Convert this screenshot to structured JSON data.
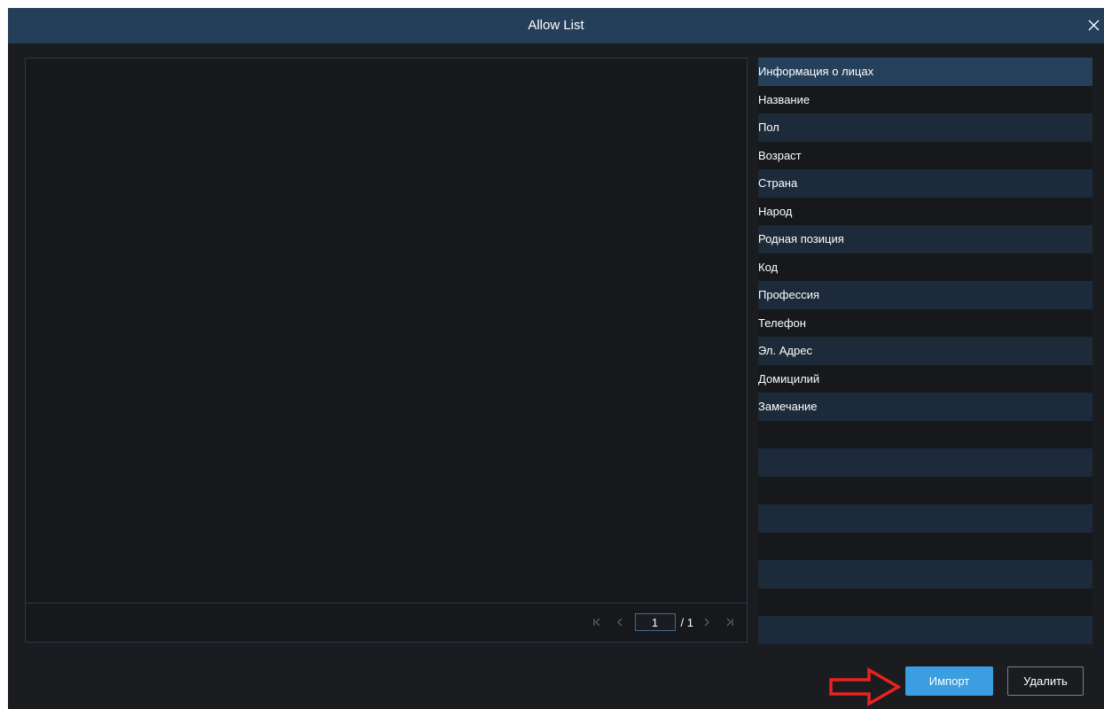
{
  "dialog": {
    "title": "Allow List",
    "close_icon": "close-icon"
  },
  "pager": {
    "current_page": "1",
    "total": "/ 1",
    "icons": [
      "first-page-icon",
      "prev-page-icon",
      "next-page-icon",
      "last-page-icon"
    ]
  },
  "info_panel": {
    "header": "Информация о лицах",
    "fields": [
      "Название",
      "Пол",
      "Возраст",
      "Страна",
      "Народ",
      "Родная позиция",
      "Код",
      "Профессия",
      "Телефон",
      "Эл. Адрес",
      "Домицилий",
      "Замечание"
    ],
    "empty_rows": 8
  },
  "buttons": {
    "import_label": "Импорт",
    "delete_label": "Удалить"
  },
  "annotation": {
    "arrow_icon": "red-arrow-annotation-icon",
    "arrow_color": "#e8231f"
  },
  "colors": {
    "titlebar": "#253f59",
    "background": "#1a1c20",
    "accent": "#3a9ee0",
    "row_alt": "#1c2a3a"
  }
}
